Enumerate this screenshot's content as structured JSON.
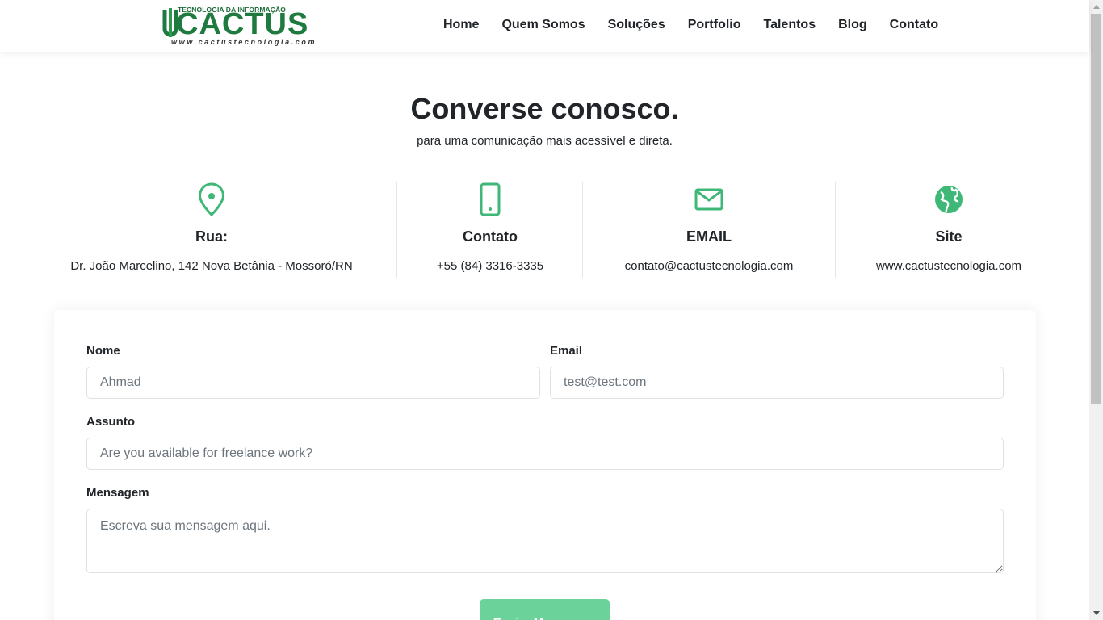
{
  "header": {
    "logo": {
      "tagline": "TECNOLOGIA DA INFORMAÇÃO",
      "brand": "CACTUS",
      "url": "www.cactustecnologia.com"
    },
    "nav": [
      "Home",
      "Quem Somos",
      "Soluções",
      "Portfolio",
      "Talentos",
      "Blog",
      "Contato"
    ]
  },
  "hero": {
    "title": "Converse conosco.",
    "subtitle": "para uma comunicação mais acessível e direta."
  },
  "contact_info": [
    {
      "icon": "map-pin-icon",
      "label": "Rua:",
      "value": "Dr. João Marcelino, 142 Nova Betânia - Mossoró/RN"
    },
    {
      "icon": "phone-icon",
      "label": "Contato",
      "value": "+55 (84) 3316-3335"
    },
    {
      "icon": "envelope-icon",
      "label": "EMAIL",
      "value": "contato@cactustecnologia.com"
    },
    {
      "icon": "globe-icon",
      "label": "Site",
      "value": "www.cactustecnologia.com"
    }
  ],
  "form": {
    "name_label": "Nome",
    "name_placeholder": "Ahmad",
    "email_label": "Email",
    "email_placeholder": "test@test.com",
    "subject_label": "Assunto",
    "subject_placeholder": "Are you available for freelance work?",
    "message_label": "Mensagem",
    "message_placeholder": "Escreva sua mensagem aqui.",
    "submit_label": "Enviar Mensagem"
  },
  "colors": {
    "accent": "#3fb877",
    "button": "#6bd39a",
    "brand": "#1f7a3f"
  }
}
